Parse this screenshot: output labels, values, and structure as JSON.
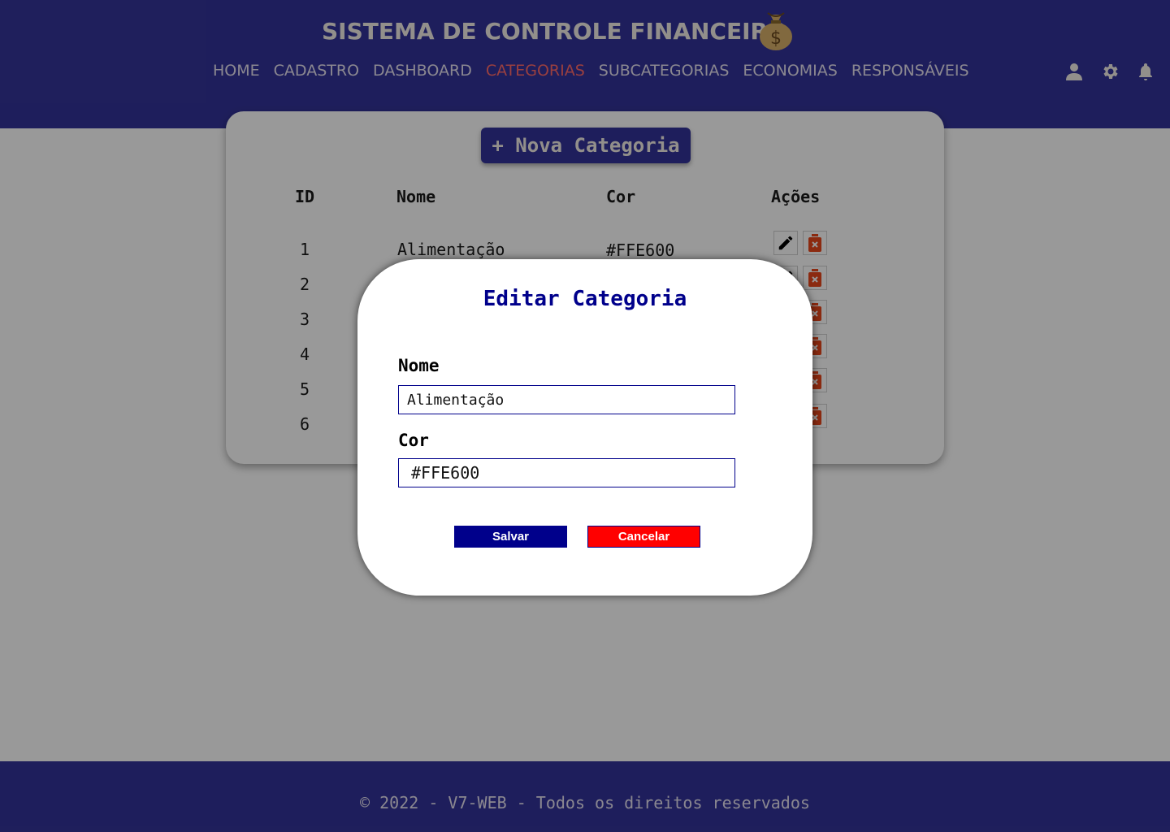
{
  "header": {
    "title": "SISTEMA DE CONTROLE FINANCEIRO",
    "nav": [
      "HOME",
      "CADASTRO",
      "DASHBOARD",
      "CATEGORIAS",
      "SUBCATEGORIAS",
      "ECONOMIAS",
      "RESPONSÁVEIS"
    ],
    "active_nav": "CATEGORIAS",
    "colors": {
      "background": "#333399",
      "active": "#ff6a6a"
    }
  },
  "toolbar": {
    "new_category_label": "+ Nova Categoria"
  },
  "table": {
    "headers": {
      "id": "ID",
      "name": "Nome",
      "color": "Cor",
      "actions": "Ações"
    },
    "rows": [
      {
        "id": "1",
        "name": "Alimentação",
        "color": "#FFE600"
      },
      {
        "id": "2"
      },
      {
        "id": "3"
      },
      {
        "id": "4"
      },
      {
        "id": "5"
      },
      {
        "id": "6"
      }
    ],
    "action_icons": [
      "pencil-icon",
      "trash-icon"
    ]
  },
  "modal": {
    "title": "Editar Categoria",
    "name_label": "Nome",
    "name_value": "Alimentação",
    "color_label": "Cor",
    "color_value": "#FFE600",
    "save_label": "Salvar",
    "cancel_label": "Cancelar",
    "colors": {
      "save": "#00008b",
      "cancel": "#ff0000"
    }
  },
  "footer": {
    "text": "© 2022 - V7-WEB - Todos os direitos reservados"
  }
}
